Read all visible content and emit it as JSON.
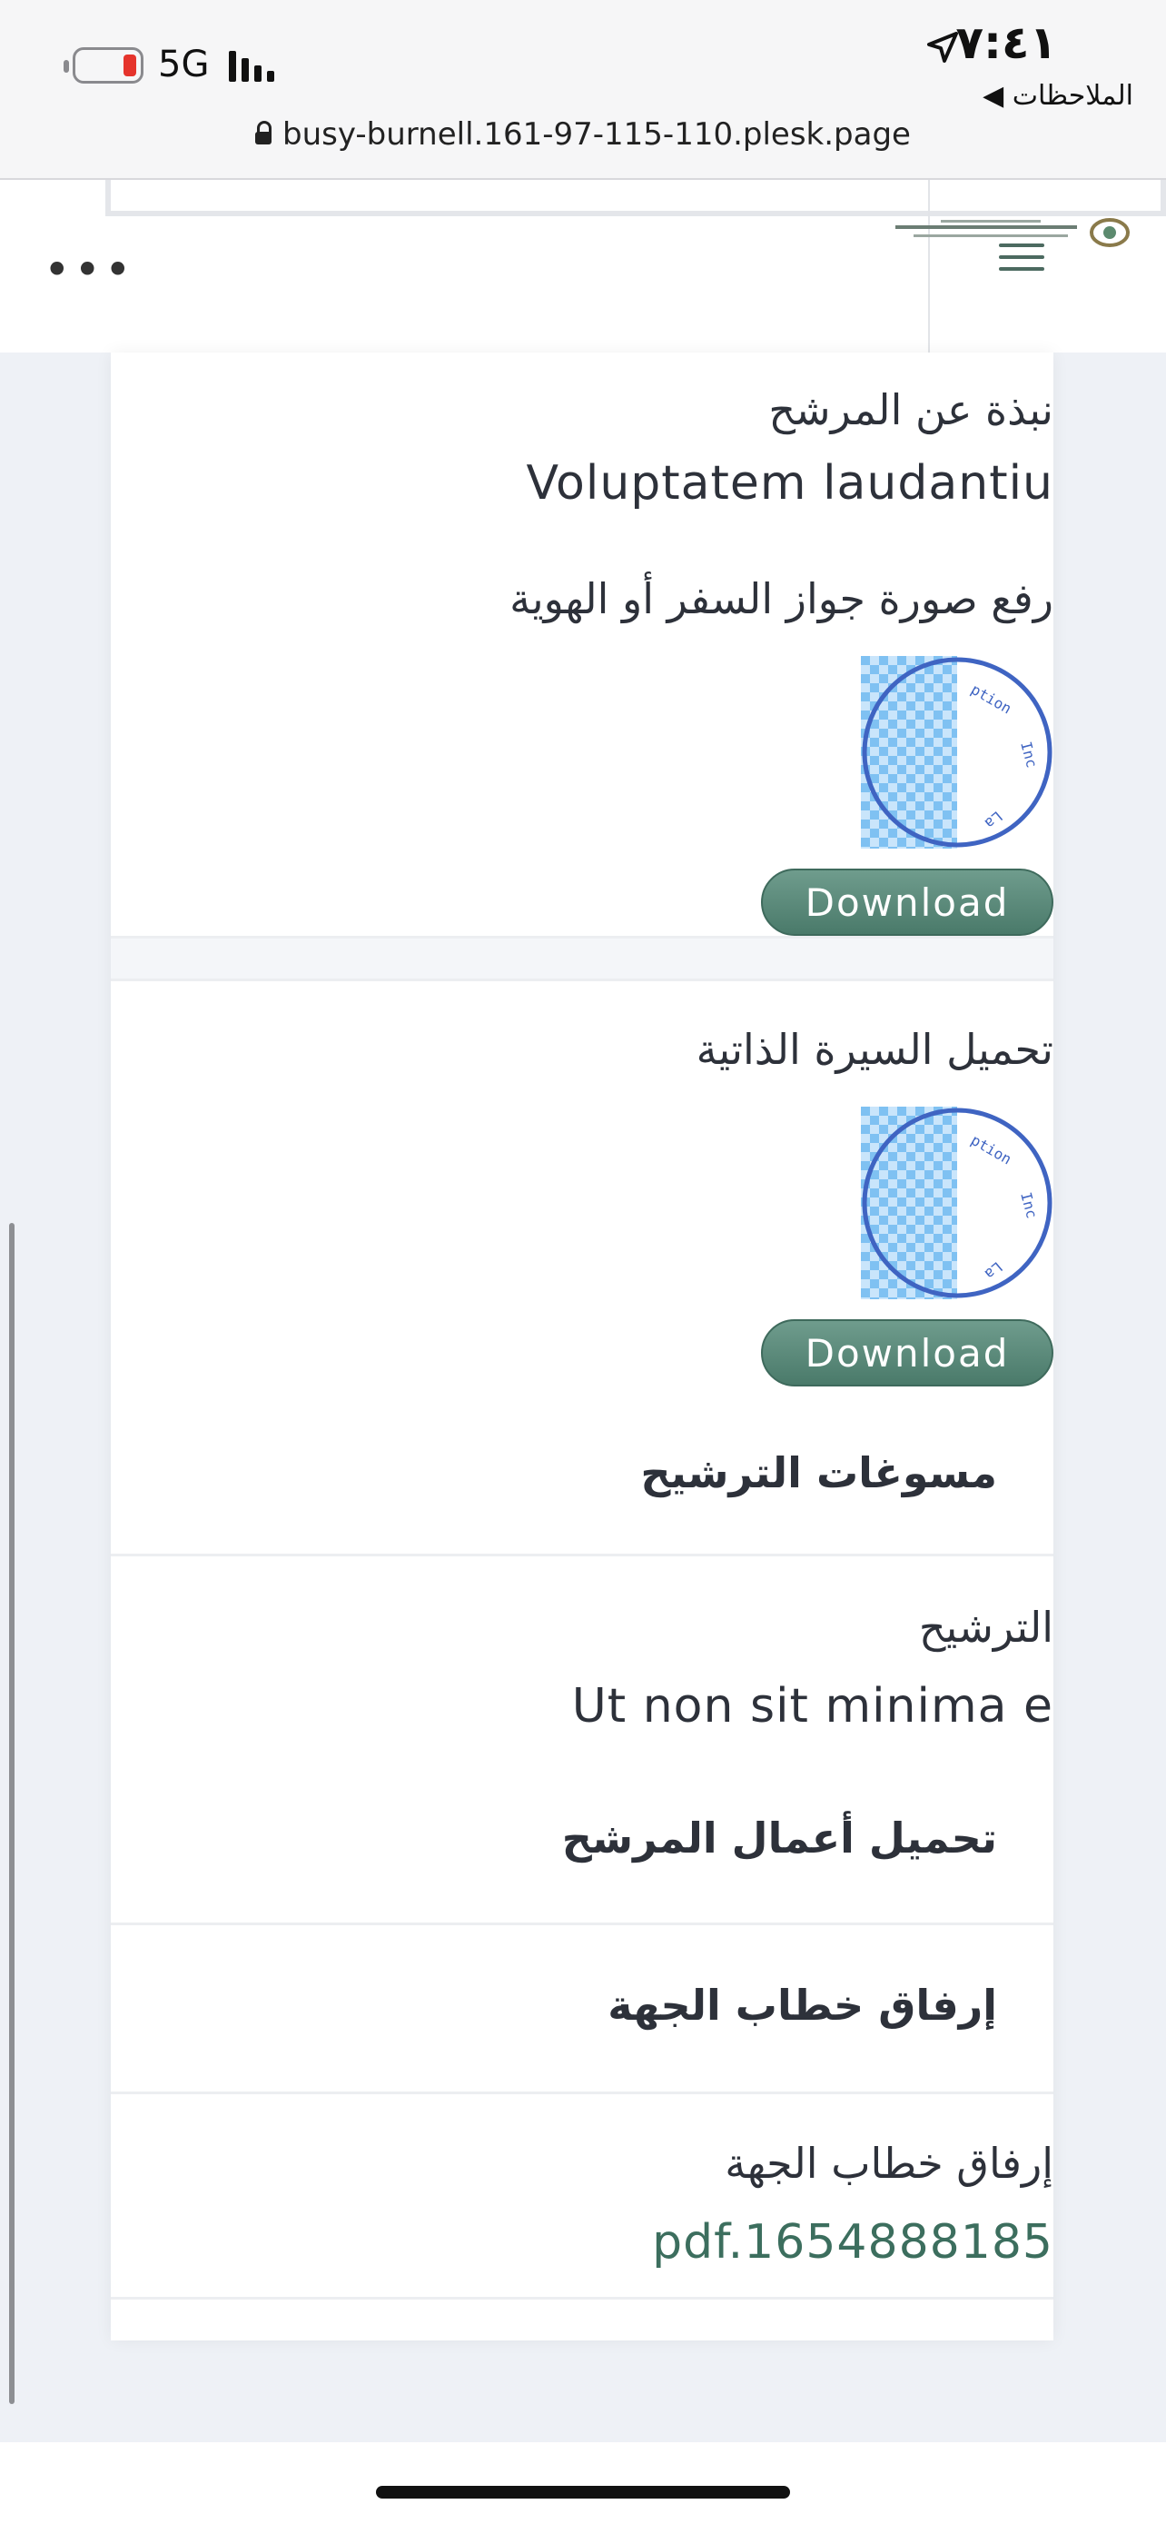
{
  "status_bar": {
    "time": "٧:٤١",
    "back_app": "◀ الملاحظات",
    "network": "5G"
  },
  "browser": {
    "url": "busy-burnell.161-97-115-110.plesk.page"
  },
  "header": {
    "more_label": "•••"
  },
  "content": {
    "about_label": "نبذة عن المرشح",
    "about_value": "Voluptatem laudantiu",
    "passport_label": "رفع صورة جواز السفر أو الهوية",
    "download_label": "Download",
    "cv_label": "تحميل السيرة الذاتية",
    "cv_download_label": "Download",
    "justifications_heading": "مسوغات الترشيح",
    "nomination_label": "الترشيح",
    "nomination_value": "Ut non sit minima e",
    "works_heading": "تحميل أعمال المرشح",
    "letter_heading": "إرفاق خطاب الجهة",
    "letter_label": "إرفاق خطاب الجهة",
    "letter_file": "pdf.1654888185"
  },
  "colors": {
    "accent": "#4a7a6a",
    "link": "#3c6e5e",
    "stamp": "#3f64c2"
  }
}
